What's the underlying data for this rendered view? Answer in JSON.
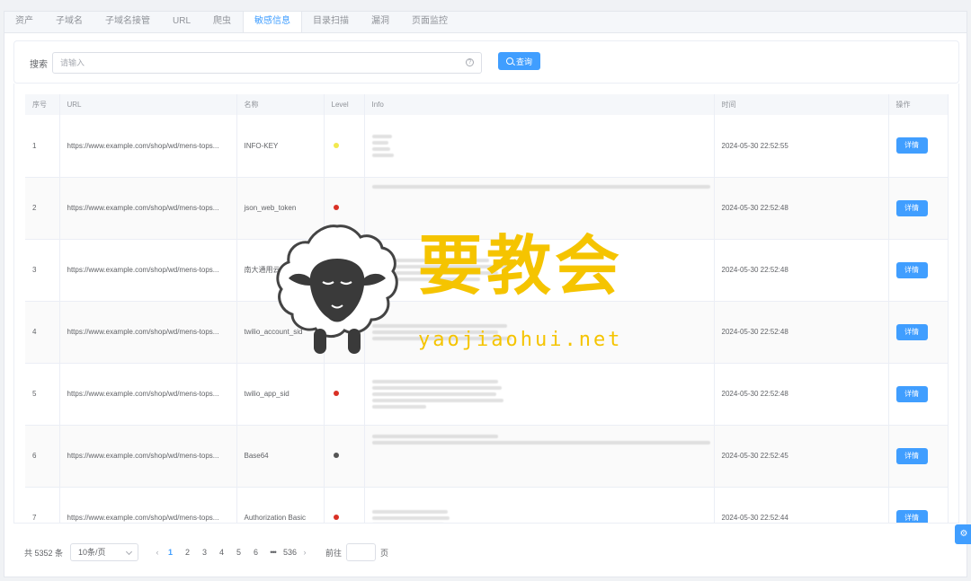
{
  "tabs": [
    "资产",
    "子域名",
    "子域名接管",
    "URL",
    "爬虫",
    "敏感信息",
    "目录扫描",
    "漏洞",
    "页面监控"
  ],
  "active_tab": 5,
  "search": {
    "label": "搜索",
    "placeholder": "请输入",
    "button": "查询"
  },
  "table": {
    "columns": [
      "序号",
      "URL",
      "名称",
      "Level",
      "Info",
      "时间",
      "操作"
    ],
    "rows": [
      {
        "no": "1",
        "url": "https://www.example.com/shop/wd/mens-tops...",
        "name": "INFO-KEY",
        "level": "#f2e94e",
        "time": "2024-05-30 22:52:55",
        "action": "详情"
      },
      {
        "no": "2",
        "url": "https://www.example.com/shop/wd/mens-tops...",
        "name": "json_web_token",
        "level": "#d93025",
        "time": "2024-05-30 22:52:48",
        "action": "详情"
      },
      {
        "no": "3",
        "url": "https://www.example.com/shop/wd/mens-tops...",
        "name": "南大通用云",
        "level": "#d93025",
        "time": "2024-05-30 22:52:48",
        "action": "详情"
      },
      {
        "no": "4",
        "url": "https://www.example.com/shop/wd/mens-tops...",
        "name": "twilio_account_sid",
        "level": "#d93025",
        "time": "2024-05-30 22:52:48",
        "action": "详情"
      },
      {
        "no": "5",
        "url": "https://www.example.com/shop/wd/mens-tops...",
        "name": "twilio_app_sid",
        "level": "#d93025",
        "time": "2024-05-30 22:52:48",
        "action": "详情"
      },
      {
        "no": "6",
        "url": "https://www.example.com/shop/wd/mens-tops...",
        "name": "Base64",
        "level": "#555555",
        "time": "2024-05-30 22:52:45",
        "action": "详情"
      },
      {
        "no": "7",
        "url": "https://www.example.com/shop/wd/mens-tops...",
        "name": "Authorization Basic",
        "level": "#d93025",
        "time": "2024-05-30 22:52:44",
        "action": "详情"
      }
    ]
  },
  "pagination": {
    "total": "共 5352 条",
    "page_size": "10条/页",
    "pages": [
      "1",
      "2",
      "3",
      "4",
      "5",
      "6"
    ],
    "active_page": "1",
    "more": "•••",
    "last_page": "536",
    "goto_label": "前往",
    "page_suffix": "页"
  },
  "watermark": {
    "title": "要教会",
    "url": "yaojiaohui.net"
  },
  "colors": {
    "accent": "#409eff",
    "watermark": "#f5c400"
  }
}
